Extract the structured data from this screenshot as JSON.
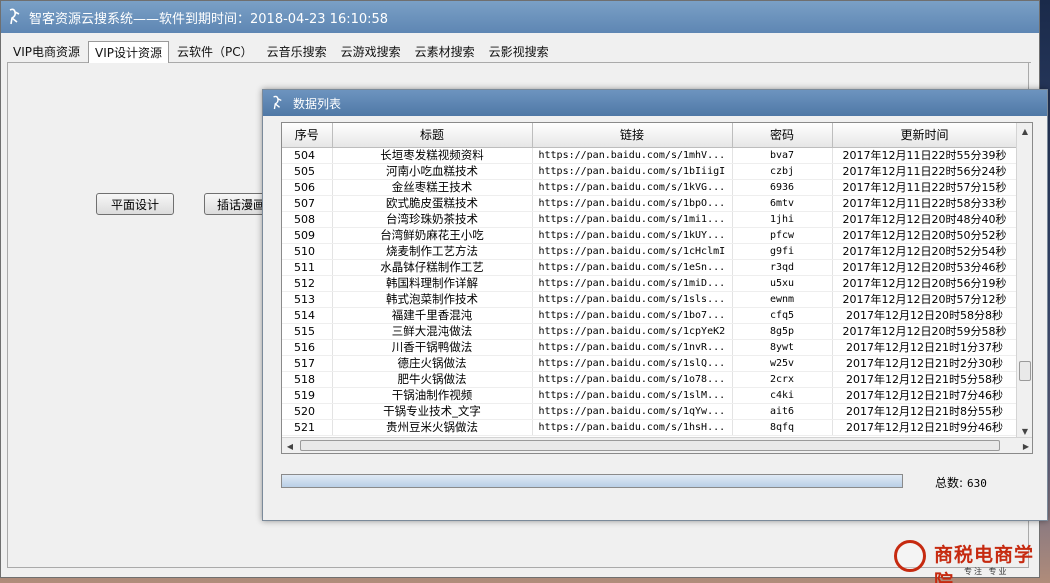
{
  "window": {
    "title": "智客资源云搜系统——软件到期时间：2018-04-23 16:10:58"
  },
  "tabs": [
    {
      "label": "VIP电商资源",
      "active": false
    },
    {
      "label": "VIP设计资源",
      "active": true
    },
    {
      "label": "云软件（PC）",
      "active": false
    },
    {
      "label": "云音乐搜索",
      "active": false
    },
    {
      "label": "云游戏搜索",
      "active": false
    },
    {
      "label": "云素材搜索",
      "active": false
    },
    {
      "label": "云影视搜索",
      "active": false
    }
  ],
  "panel": {
    "buttons": [
      "平面设计",
      "插话漫画"
    ]
  },
  "dialog": {
    "title": "数据列表",
    "columns": [
      "序号",
      "标题",
      "链接",
      "密码",
      "更新时间"
    ],
    "rows": [
      {
        "no": "504",
        "title": "长垣枣发糕视频资料",
        "link": "https://pan.baidu.com/s/1mhV...",
        "pwd": "bva7",
        "time": "2017年12月11日22时55分39秒"
      },
      {
        "no": "505",
        "title": "河南小吃血糕技术",
        "link": "https://pan.baidu.com/s/1bIiigI",
        "pwd": "czbj",
        "time": "2017年12月11日22时56分24秒"
      },
      {
        "no": "506",
        "title": "金丝枣糕王技术",
        "link": "https://pan.baidu.com/s/1kVG...",
        "pwd": "6936",
        "time": "2017年12月11日22时57分15秒"
      },
      {
        "no": "507",
        "title": "欧式脆皮蛋糕技术",
        "link": "https://pan.baidu.com/s/1bpO...",
        "pwd": "6mtv",
        "time": "2017年12月11日22时58分33秒"
      },
      {
        "no": "508",
        "title": "台湾珍珠奶茶技术",
        "link": "https://pan.baidu.com/s/1mi1...",
        "pwd": "1jhi",
        "time": "2017年12月12日20时48分40秒"
      },
      {
        "no": "509",
        "title": "台湾鲜奶麻花王小吃",
        "link": "https://pan.baidu.com/s/1kUY...",
        "pwd": "pfcw",
        "time": "2017年12月12日20时50分52秒"
      },
      {
        "no": "510",
        "title": "烧麦制作工艺方法",
        "link": "https://pan.baidu.com/s/1cHclmI",
        "pwd": "g9fi",
        "time": "2017年12月12日20时52分54秒"
      },
      {
        "no": "511",
        "title": "水晶钵仔糕制作工艺",
        "link": "https://pan.baidu.com/s/1eSn...",
        "pwd": "r3qd",
        "time": "2017年12月12日20时53分46秒"
      },
      {
        "no": "512",
        "title": "韩国料理制作详解",
        "link": "https://pan.baidu.com/s/1miD...",
        "pwd": "u5xu",
        "time": "2017年12月12日20时56分19秒"
      },
      {
        "no": "513",
        "title": "韩式泡菜制作技术",
        "link": "https://pan.baidu.com/s/1sls...",
        "pwd": "ewnm",
        "time": "2017年12月12日20时57分12秒"
      },
      {
        "no": "514",
        "title": "福建千里香混沌",
        "link": "https://pan.baidu.com/s/1bo7...",
        "pwd": "cfq5",
        "time": "2017年12月12日20时58分8秒"
      },
      {
        "no": "515",
        "title": "三鲜大混沌做法",
        "link": "https://pan.baidu.com/s/1cpYeK2",
        "pwd": "8g5p",
        "time": "2017年12月12日20时59分58秒"
      },
      {
        "no": "516",
        "title": "川香干锅鸭做法",
        "link": "https://pan.baidu.com/s/1nvR...",
        "pwd": "8ywt",
        "time": "2017年12月12日21时1分37秒"
      },
      {
        "no": "517",
        "title": "德庄火锅做法",
        "link": "https://pan.baidu.com/s/1slQ...",
        "pwd": "w25v",
        "time": "2017年12月12日21时2分30秒"
      },
      {
        "no": "518",
        "title": "肥牛火锅做法",
        "link": "https://pan.baidu.com/s/1o78...",
        "pwd": "2crx",
        "time": "2017年12月12日21时5分58秒"
      },
      {
        "no": "519",
        "title": "干锅油制作视频",
        "link": "https://pan.baidu.com/s/1slM...",
        "pwd": "c4ki",
        "time": "2017年12月12日21时7分46秒"
      },
      {
        "no": "520",
        "title": "干锅专业技术_文字",
        "link": "https://pan.baidu.com/s/1qYw...",
        "pwd": "ait6",
        "time": "2017年12月12日21时8分55秒"
      },
      {
        "no": "521",
        "title": "贵州豆米火锅做法",
        "link": "https://pan.baidu.com/s/1hsH...",
        "pwd": "8qfq",
        "time": "2017年12月12日21时9分46秒"
      }
    ],
    "progress_fraction": 1.0,
    "total_label": "总数:",
    "total_value": "630"
  },
  "brand": {
    "name": "商税电商学院",
    "tagline": "专注 专业"
  },
  "colors": {
    "titlebar": "#6d94bf",
    "brand_red": "#c62a10"
  }
}
